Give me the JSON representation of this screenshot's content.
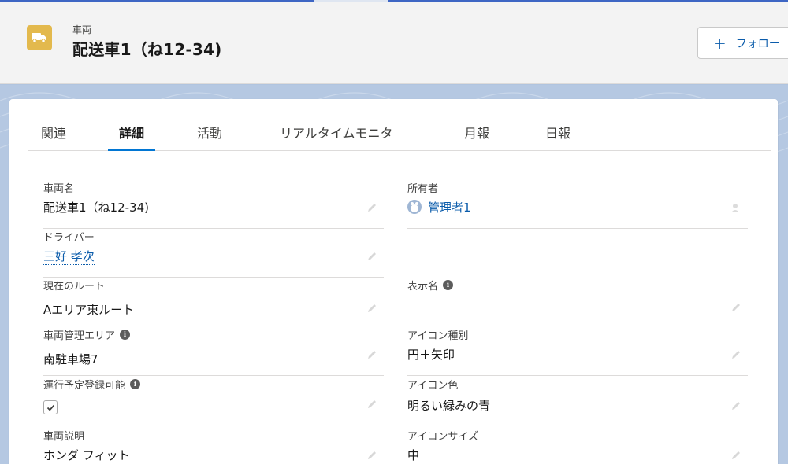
{
  "header": {
    "object_type": "車両",
    "record_title": "配送車1（ね12-34)",
    "follow_label": "フォロー",
    "follow_icon": "plus-icon",
    "object_icon": "truck-icon",
    "object_icon_color": "#e3b94d"
  },
  "tabs": [
    {
      "label": "関連",
      "active": false
    },
    {
      "label": "詳細",
      "active": true
    },
    {
      "label": "活動",
      "active": false
    },
    {
      "label": "リアルタイムモニタ",
      "active": false
    },
    {
      "label": "月報",
      "active": false
    },
    {
      "label": "日報",
      "active": false
    }
  ],
  "fields": {
    "vehicle_name": {
      "label": "車両名",
      "value": "配送車1（ね12-34)"
    },
    "owner": {
      "label": "所有者",
      "value": "管理者1"
    },
    "driver": {
      "label": "ドライバー",
      "value": "三好 孝次"
    },
    "current_route": {
      "label": "現在のルート",
      "value": "Aエリア東ルート"
    },
    "display_name": {
      "label": "表示名",
      "value": ""
    },
    "management_area": {
      "label": "車両管理エリア",
      "value": "南駐車場7"
    },
    "icon_type": {
      "label": "アイコン種別",
      "value": "円＋矢印"
    },
    "schedule_registrable": {
      "label": "運行予定登録可能",
      "checked": true
    },
    "icon_color": {
      "label": "アイコン色",
      "value": "明るい緑みの青"
    },
    "vehicle_description": {
      "label": "車両説明",
      "value": "ホンダ フィット"
    },
    "icon_size": {
      "label": "アイコンサイズ",
      "value": "中"
    }
  },
  "colors": {
    "accent": "#0176d3",
    "link": "#0b5cab"
  }
}
